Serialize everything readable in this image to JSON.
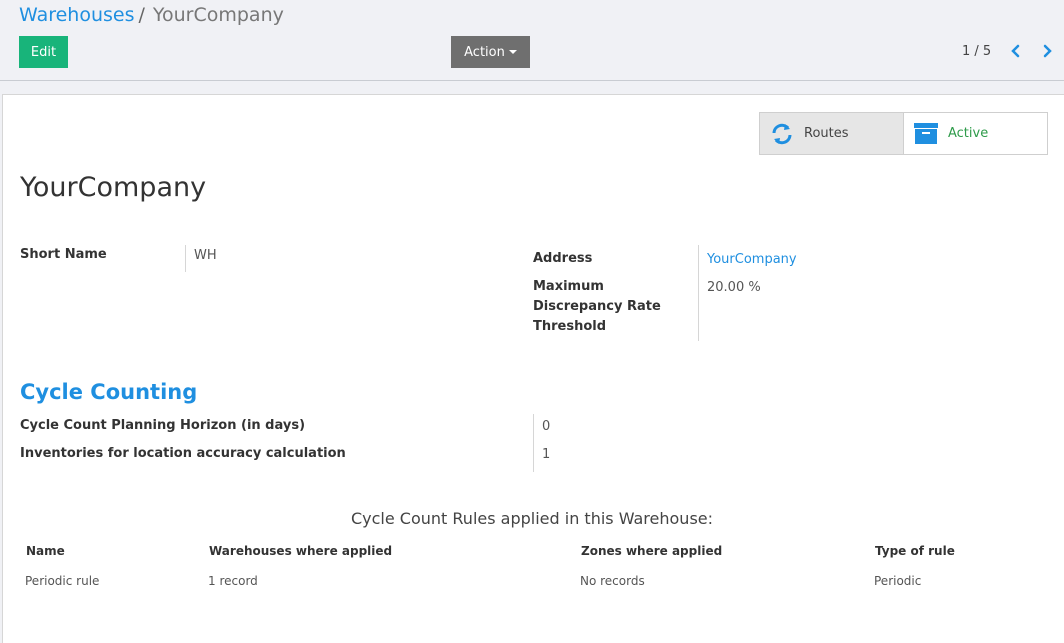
{
  "breadcrumb": {
    "parent": "Warehouses",
    "separator": "/",
    "current": "YourCompany"
  },
  "toolbar": {
    "edit_label": "Edit",
    "action_label": "Action"
  },
  "pager": {
    "text": "1 / 5"
  },
  "stat_buttons": {
    "routes_label": "Routes",
    "active_label": "Active"
  },
  "record": {
    "title": "YourCompany",
    "short_name_label": "Short Name",
    "short_name_value": "WH",
    "address_label": "Address",
    "address_value": "YourCompany",
    "discrepancy_label_line1": "Maximum",
    "discrepancy_label_line2": "Discrepancy Rate",
    "discrepancy_label_line3": "Threshold",
    "discrepancy_value": "20.00 %"
  },
  "cycle_counting": {
    "section_title": "Cycle Counting",
    "horizon_label": "Cycle Count Planning Horizon (in days)",
    "horizon_value": "0",
    "inventories_label": "Inventories for location accuracy calculation",
    "inventories_value": "1"
  },
  "rules_table": {
    "title": "Cycle Count Rules applied in this Warehouse:",
    "headers": [
      "Name",
      "Warehouses where applied",
      "Zones where applied",
      "Type of rule"
    ],
    "rows": [
      [
        "Periodic rule",
        "1 record",
        "No records",
        "Periodic"
      ]
    ]
  },
  "colors": {
    "accent": "#1f8fe0",
    "edit_button": "#18b47a",
    "action_button": "#6f6f6f",
    "active_text": "#2e9b4a"
  }
}
